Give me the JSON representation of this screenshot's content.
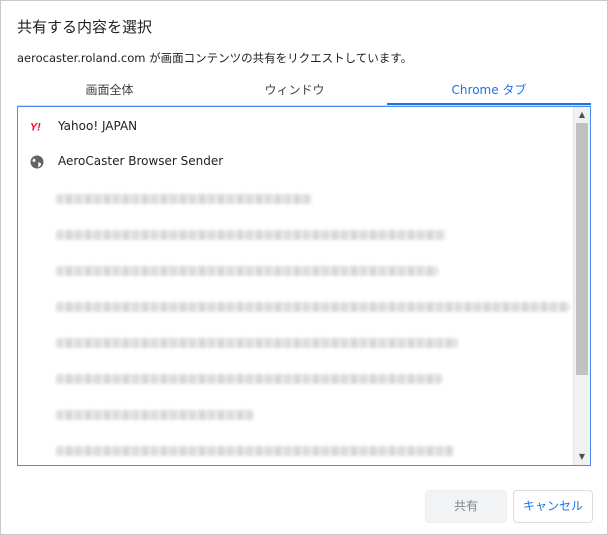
{
  "dialog": {
    "title": "共有する内容を選択",
    "subtitle": "aerocaster.roland.com が画面コンテンツの共有をリクエストしています。"
  },
  "tabs": [
    {
      "label": "画面全体",
      "selected": false
    },
    {
      "label": "ウィンドウ",
      "selected": false
    },
    {
      "label": "Chrome タブ",
      "selected": true
    }
  ],
  "list": {
    "items": [
      {
        "icon": "yahoo-logo-icon",
        "label": "Yahoo! JAPAN"
      },
      {
        "icon": "globe-icon",
        "label": "AeroCaster Browser Sender"
      }
    ]
  },
  "buttons": {
    "share": "共有",
    "cancel": "キャンセル"
  },
  "colors": {
    "accent": "#1a73e8",
    "list_border": "#4a8df0",
    "yahoo_red": "#ff0033",
    "disabled_button_bg": "#f1f3f4"
  }
}
